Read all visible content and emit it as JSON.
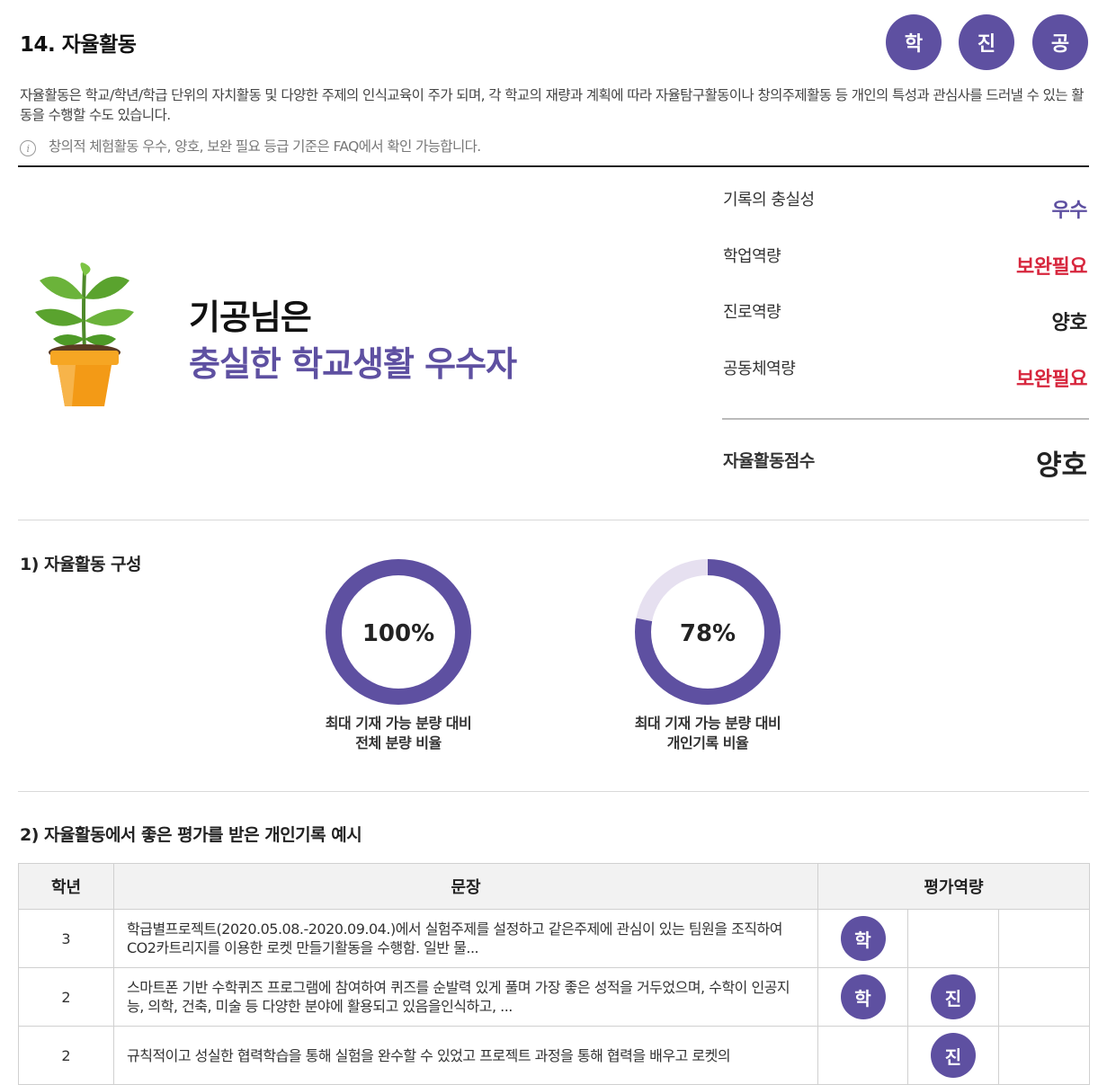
{
  "header": {
    "title": "14. 자율활동",
    "buttons": [
      "학",
      "진",
      "공"
    ]
  },
  "description": "자율활동은 학교/학년/학급 단위의 자치활동 및 다양한 주제의 인식교육이 주가 되며, 각 학교의 재량과 계획에 따라 자율탐구활동이나 창의주제활동 등 개인의 특성과 관심사를 드러낼 수 있는 활동을 수행할 수도 있습니다.",
  "info_note": "창의적 체험활동 우수, 양호, 보완 필요 등급 기준은 FAQ에서 확인 가능합니다.",
  "info_icon": "info-icon",
  "summary": {
    "icon": "plant-pot-icon",
    "line1": "기공님은",
    "line2": "충실한 학교생활 우수자"
  },
  "evaluations": [
    {
      "label": "기록의 충실성",
      "value": "우수",
      "color": "#5e50a1"
    },
    {
      "label": "학업역량",
      "value": "보완필요",
      "color": "#d7263d"
    },
    {
      "label": "진로역량",
      "value": "양호",
      "color": "#222222"
    },
    {
      "label": "공동체역량",
      "value": "보완필요",
      "color": "#d7263d"
    }
  ],
  "score": {
    "label": "자율활동점수",
    "value": "양호"
  },
  "section1": {
    "title": "1) 자율활동 구성",
    "donuts": [
      {
        "percent": 100,
        "label": "100%",
        "caption1": "최대 기재 가능 분량 대비",
        "caption2": "전체 분량 비율"
      },
      {
        "percent": 78,
        "label": "78%",
        "caption1": "최대 기재 가능 분량 대비",
        "caption2": "개인기록 비율"
      }
    ],
    "colors": {
      "fill": "#5e50a1",
      "track": "#e6e0f0"
    }
  },
  "section2": {
    "title": "2) 자율활동에서 좋은 평가를 받은 개인기록 예시",
    "headers": {
      "grade": "학년",
      "sentence": "문장",
      "competency": "평가역량"
    },
    "rows": [
      {
        "grade": "3",
        "sentence": "학급별프로젝트(2020.05.08.-2020.09.04.)에서 실험주제를 설정하고 같은주제에 관심이 있는 팀원을 조직하여 CO2카트리지를 이용한 로켓 만들기활동을 수행함. 일반 물...",
        "badges": [
          "학",
          "",
          ""
        ]
      },
      {
        "grade": "2",
        "sentence": "스마트폰 기반 수학퀴즈 프로그램에 참여하여 퀴즈를 순발력 있게 풀며 가장 좋은 성적을 거두었으며, 수학이 인공지능, 의학, 건축, 미술 등 다양한 분야에 활용되고 있음을인식하고, ...",
        "badges": [
          "학",
          "진",
          ""
        ]
      },
      {
        "grade": "2",
        "sentence": "규칙적이고 성실한 협력학습을 통해 실험을 완수할 수 있었고 프로젝트 과정을 통해 협력을 배우고 로켓의",
        "badges": [
          "",
          "진",
          ""
        ]
      }
    ]
  }
}
